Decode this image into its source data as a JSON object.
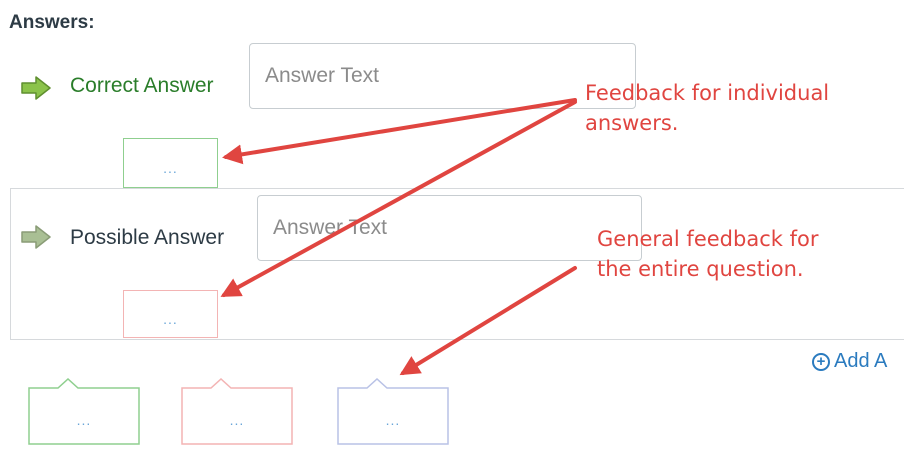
{
  "heading": "Answers:",
  "correct_answer": {
    "label": "Correct Answer",
    "placeholder": "Answer Text",
    "feedback_label": "..."
  },
  "possible_answer": {
    "label": "Possible Answer",
    "placeholder": "Answer Text",
    "feedback_label": "..."
  },
  "add_answer": {
    "label": "Add A"
  },
  "general_feedback": {
    "correct_label": "...",
    "incorrect_label": "...",
    "neutral_label": "..."
  },
  "annotations": {
    "individual_line1": "Feedback for individual",
    "individual_line2": "answers.",
    "general_line1": "General feedback for",
    "general_line2": "the entire question."
  },
  "colors": {
    "correct_green": "#2a7d2a",
    "annotation_red": "#e04540",
    "link_blue": "#2b7bbf",
    "arrow_icon_active": "#8bc34a",
    "arrow_icon_inactive": "#a9bf94"
  },
  "icons": {
    "correct_arrow": "right-arrow-icon",
    "possible_arrow": "right-arrow-icon",
    "add": "plus-circle-icon"
  }
}
